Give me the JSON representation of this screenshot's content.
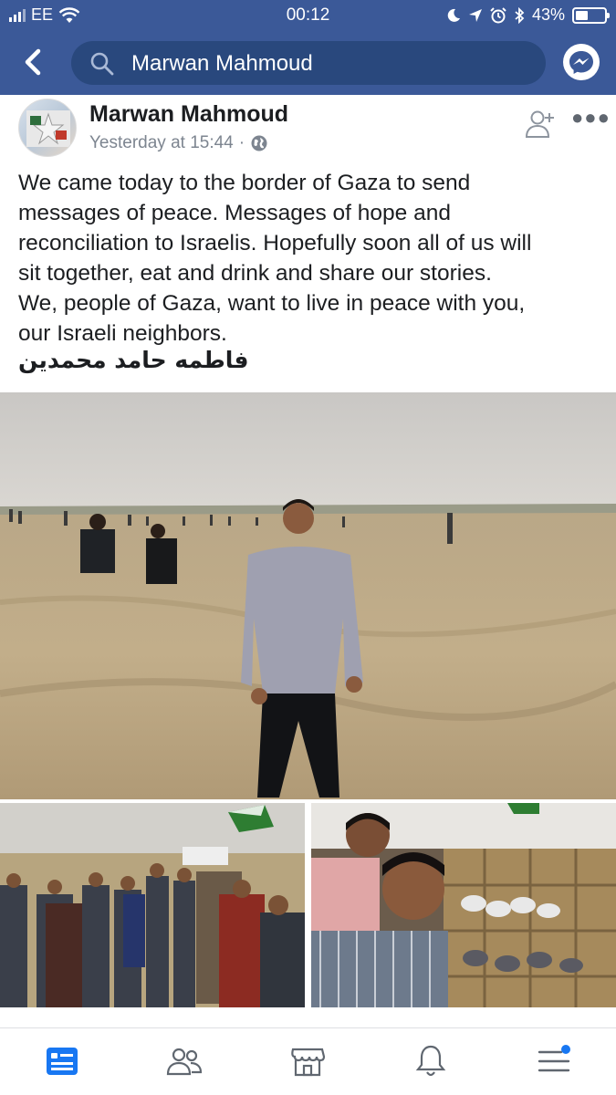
{
  "status_bar": {
    "carrier": "EE",
    "time": "00:12",
    "battery_percent": "43%",
    "battery_level": 0.43
  },
  "search": {
    "query": "Marwan Mahmoud"
  },
  "post": {
    "author": "Marwan Mahmoud",
    "timestamp": "Yesterday at 15:44",
    "separator": "·",
    "privacy_icon": "globe-icon",
    "text": "We came today to the border of Gaza to send\nmessages of peace. Messages of hope and\nreconciliation to Israelis. Hopefully soon all of us  will\nsit together, eat and drink and share our stories.\nWe, people of Gaza, want to live in peace with you,\nour Israeli neighbors.",
    "signature": "فاطمه حامد محمدين"
  },
  "tabs": [
    {
      "name": "news-feed",
      "icon": "news-feed-icon",
      "active": true
    },
    {
      "name": "friends",
      "icon": "friends-icon",
      "active": false
    },
    {
      "name": "marketplace",
      "icon": "marketplace-icon",
      "active": false
    },
    {
      "name": "notifications",
      "icon": "bell-icon",
      "active": false
    },
    {
      "name": "menu",
      "icon": "menu-icon",
      "active": false
    }
  ],
  "colors": {
    "header": "#3b5998",
    "search_bg": "#29487d",
    "active_tab": "#1877f2",
    "inactive_tab": "#606770"
  }
}
